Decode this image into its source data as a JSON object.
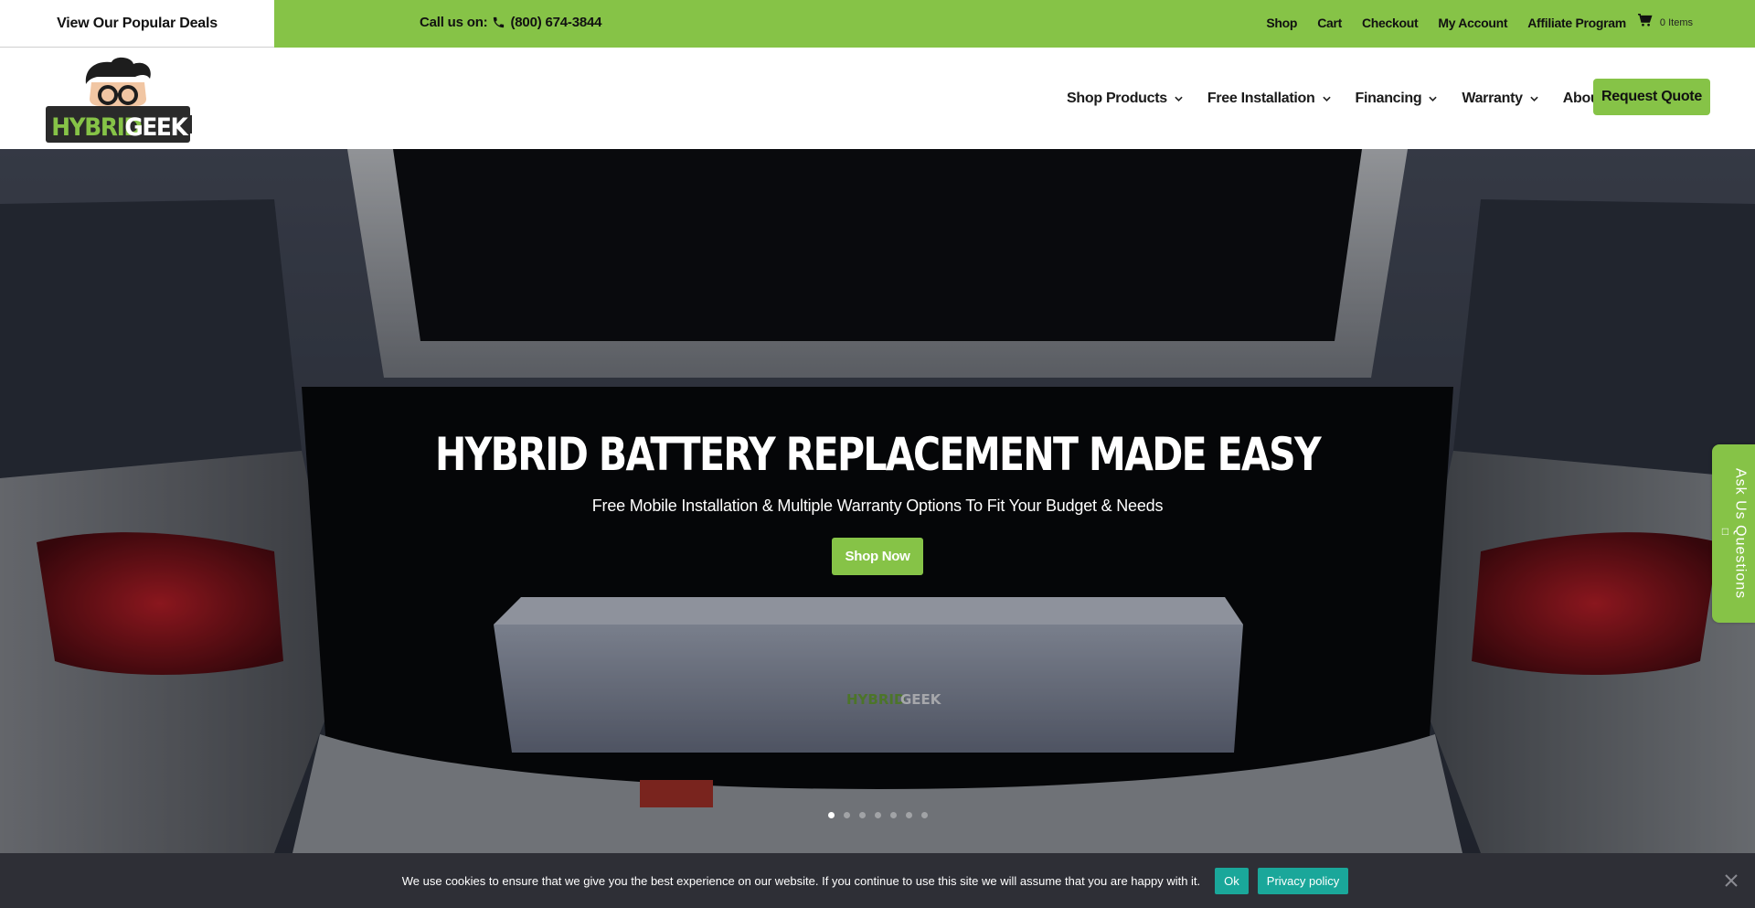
{
  "topbar": {
    "deals_label": "View Our Popular Deals",
    "call_prefix": "Call us on:",
    "phone": "(800) 674-3844",
    "links": [
      "Shop",
      "Cart",
      "Checkout",
      "My Account",
      "Affiliate Program"
    ],
    "cart_count": "0 Items"
  },
  "header": {
    "logo_text_left": "HYBRID",
    "logo_text_right": "GEEK",
    "nav": [
      {
        "label": "Shop Products"
      },
      {
        "label": "Free Installation"
      },
      {
        "label": "Financing"
      },
      {
        "label": "Warranty"
      },
      {
        "label": "About"
      }
    ],
    "quote_label": "Request Quote"
  },
  "hero": {
    "title": "HYBRID BATTERY REPLACEMENT MADE EASY",
    "subtitle": "Free Mobile Installation & Multiple Warranty Options To Fit Your Budget & Needs",
    "button_label": "Shop Now",
    "battery_logo_left": "HYBRID",
    "battery_logo_right": "GEEK",
    "slides": 7,
    "active_slide": 1
  },
  "side_tab": {
    "label": "Ask Us Questions"
  },
  "cookie": {
    "text": "We use cookies to ensure that we give you the best experience on our website. If you continue to use this site we will assume that you are happy with it.",
    "ok_label": "Ok",
    "privacy_label": "Privacy policy"
  },
  "colors": {
    "brand_green": "#86c347",
    "cookie_bg": "#2e2f36",
    "cookie_button": "#1aa79a"
  }
}
